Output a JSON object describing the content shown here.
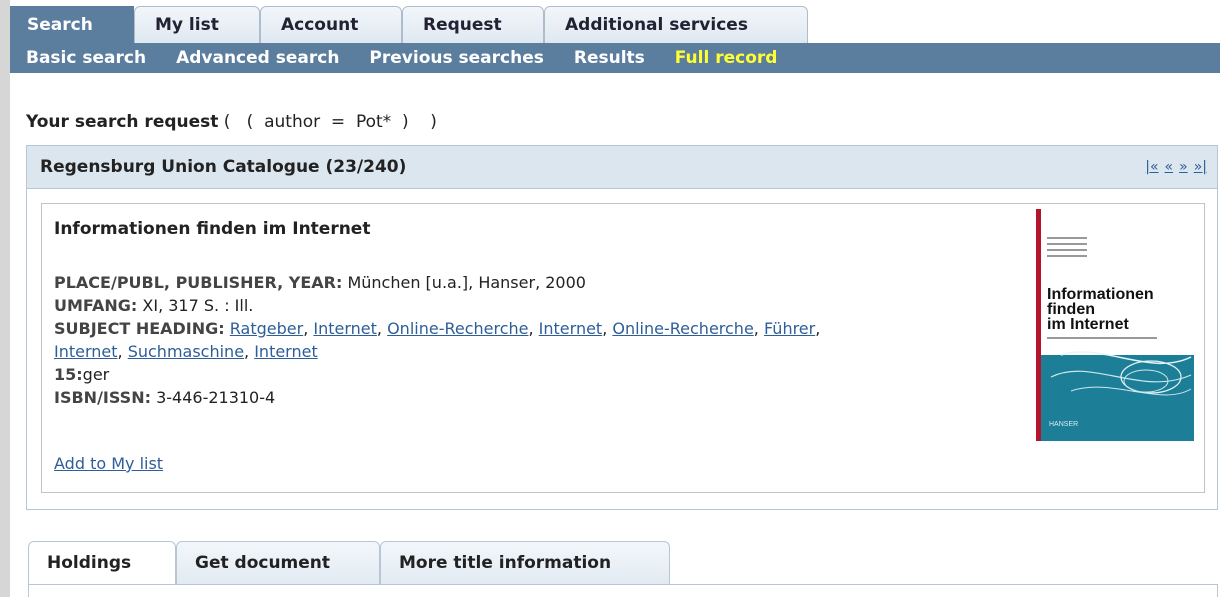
{
  "top_tabs": {
    "search": "Search",
    "my_list": "My list",
    "account": "Account",
    "request": "Request",
    "additional": "Additional services"
  },
  "subnav": {
    "basic": "Basic search",
    "advanced": "Advanced search",
    "previous": "Previous searches",
    "results": "Results",
    "full_record": "Full record"
  },
  "search_request": {
    "label": "Your search request",
    "query": " (   (  author  =  Pot*  )    )"
  },
  "catalogue": {
    "title": "Regensburg Union Catalogue (23/240)",
    "nav": {
      "first": "|«",
      "prev": "«",
      "next": "»",
      "last": "»|"
    }
  },
  "record": {
    "title": "Informationen finden im Internet",
    "place_label": "PLACE/PUBL, PUBLISHER, YEAR:",
    "place_value": " München [u.a.], Hanser, 2000",
    "umfang_label": "UMFANG:",
    "umfang_value": " XI, 317 S. : Ill.",
    "subject_label": "SUBJECT HEADING:",
    "subjects": [
      "Ratgeber",
      "Internet",
      "Online-Recherche",
      "Internet",
      "Online-Recherche",
      "Führer",
      "Internet",
      "Suchmaschine",
      "Internet"
    ],
    "lang_label": "15:",
    "lang_value": "ger",
    "isbn_label": "ISBN/ISSN:",
    "isbn_value": " 3-446-21310-4",
    "add_link": "Add to My list"
  },
  "cover": {
    "title_line1": "Informationen",
    "title_line2": "finden",
    "title_line3": "im Internet",
    "publisher": "HANSER"
  },
  "bottom_tabs": {
    "holdings": "Holdings",
    "get_document": "Get document",
    "more_info": "More title information"
  },
  "colors": {
    "nav_bar": "#5b7d9e",
    "current_item": "#ffff33",
    "link": "#2d5e9a",
    "header_bg": "#dce6ef"
  }
}
